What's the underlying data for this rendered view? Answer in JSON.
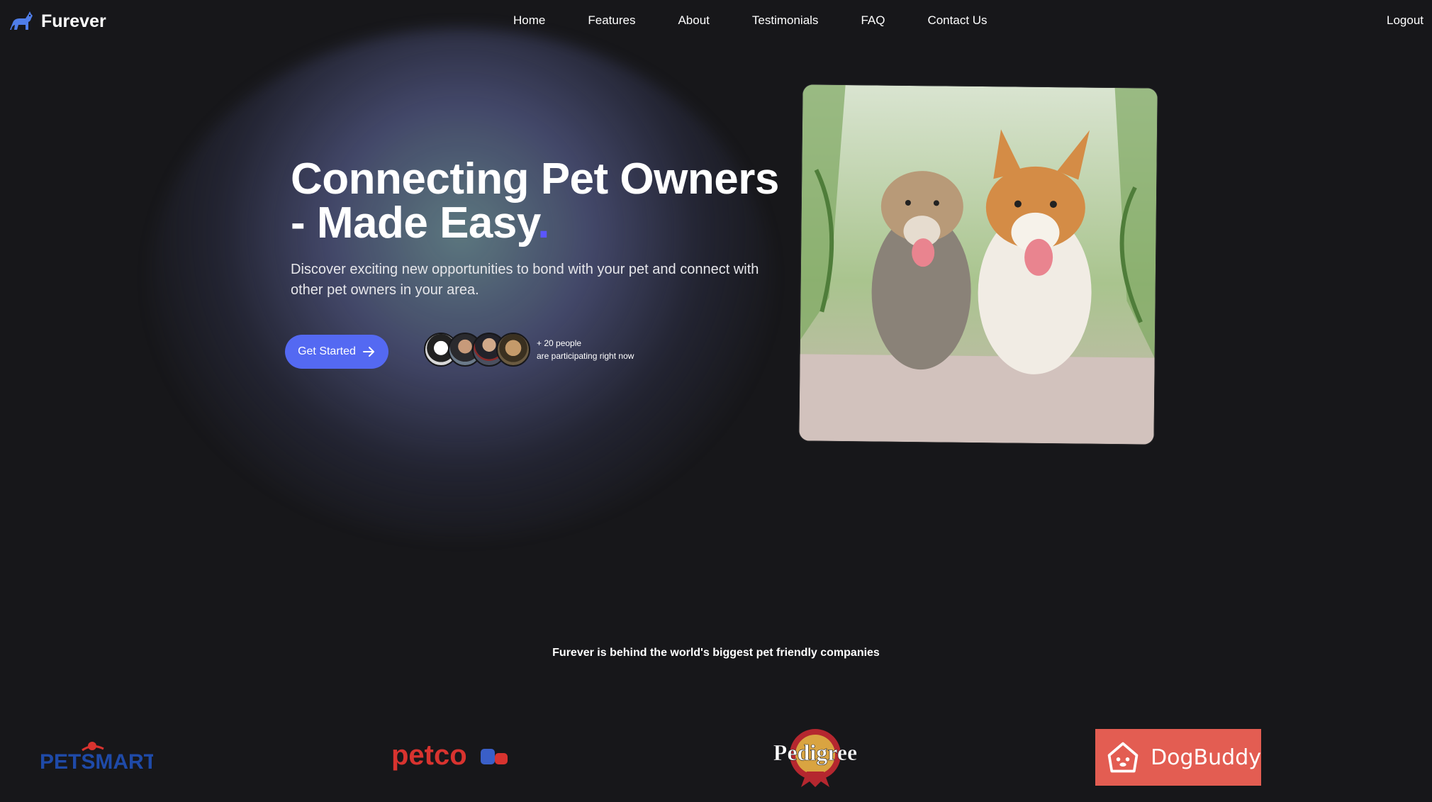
{
  "nav": {
    "logo_text": "Furever",
    "links": [
      "Home",
      "Features",
      "About",
      "Testimonials",
      "FAQ",
      "Contact Us"
    ],
    "logout": "Logout"
  },
  "hero": {
    "title_line1": "Connecting Pet Owners",
    "title_line2": "- Made Easy",
    "title_dot": ".",
    "subtitle": "Discover exciting new opportunities to bond with your pet and connect with other pet owners in your area.",
    "cta_label": "Get Started",
    "people_count": "+ 20 people",
    "people_status": "are participating right now"
  },
  "partners": {
    "tagline": "Furever is behind the world's biggest pet friendly companies",
    "logos": [
      "PETSMART",
      "petco",
      "Pedigree",
      "DogBuddy"
    ]
  },
  "colors": {
    "background": "#17171a",
    "accent": "#5469f2",
    "title_dot": "#5b56ff",
    "dogbuddy": "#e35d52",
    "petsmart": "#1f4aa8",
    "petco": "#d8332f",
    "pedigree": "#b5272f"
  }
}
